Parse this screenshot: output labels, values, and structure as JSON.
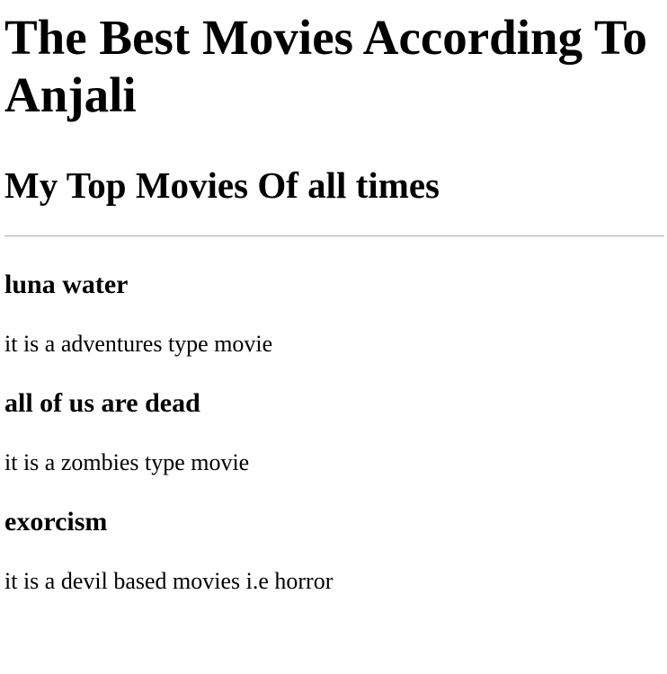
{
  "page": {
    "title": "The Best Movies According To Anjali",
    "subtitle": "My Top Movies Of all times"
  },
  "movies": [
    {
      "name": "luna water",
      "description": "it is a adventures type movie"
    },
    {
      "name": "all of us are dead",
      "description": "it is a zombies type movie"
    },
    {
      "name": "exorcism",
      "description": "it is a devil based movies i.e horror"
    }
  ]
}
